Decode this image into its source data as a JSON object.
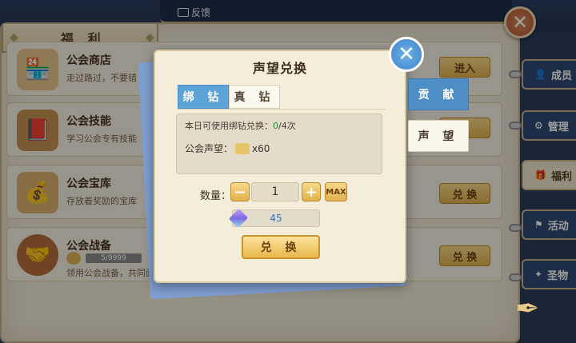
{
  "header": {
    "title": "福 利",
    "feedback_label": "反馈"
  },
  "rows": [
    {
      "name": "公会商店",
      "desc": "走过路过，不要错",
      "action": "进入",
      "icon": "shop-icon"
    },
    {
      "name": "公会技能",
      "desc": "学习公会专有技能",
      "action": "",
      "icon": "skill-book-icon"
    },
    {
      "name": "公会宝库",
      "desc": "存放着奖励的宝库",
      "action": "兑 换",
      "icon": "treasure-icon"
    },
    {
      "name": "公会战备",
      "desc": "领用公会战备，共同面",
      "progress_text": "5/9999",
      "action": "兑 换",
      "icon": "war-badge-icon"
    }
  ],
  "side_tabs": [
    {
      "label": "成员",
      "active": false
    },
    {
      "label": "管理",
      "active": false
    },
    {
      "label": "福利",
      "active": true
    },
    {
      "label": "活动",
      "active": false
    },
    {
      "label": "圣物",
      "active": false
    }
  ],
  "modal": {
    "title": "声望兑换",
    "tabs": [
      "绑 钻",
      "真 钻"
    ],
    "active_tab": 0,
    "daily_text": "本日可使用绑钻兑换：",
    "daily_used": "0",
    "daily_total": "/4次",
    "reputation_label": "公会声望：",
    "reputation_amount": "x60",
    "quantity_label": "数量：",
    "quantity_value": "1",
    "max_label": "MAX",
    "cost_value": "45",
    "exchange_label": "兑 换",
    "minus_symbol": "−",
    "plus_symbol": "+"
  },
  "sub_tabs": [
    "贡 献",
    "声 望"
  ],
  "colors": {
    "primary_blue": "#4e8ec7",
    "gold": "#e2b14a",
    "paper": "#f3edda"
  }
}
